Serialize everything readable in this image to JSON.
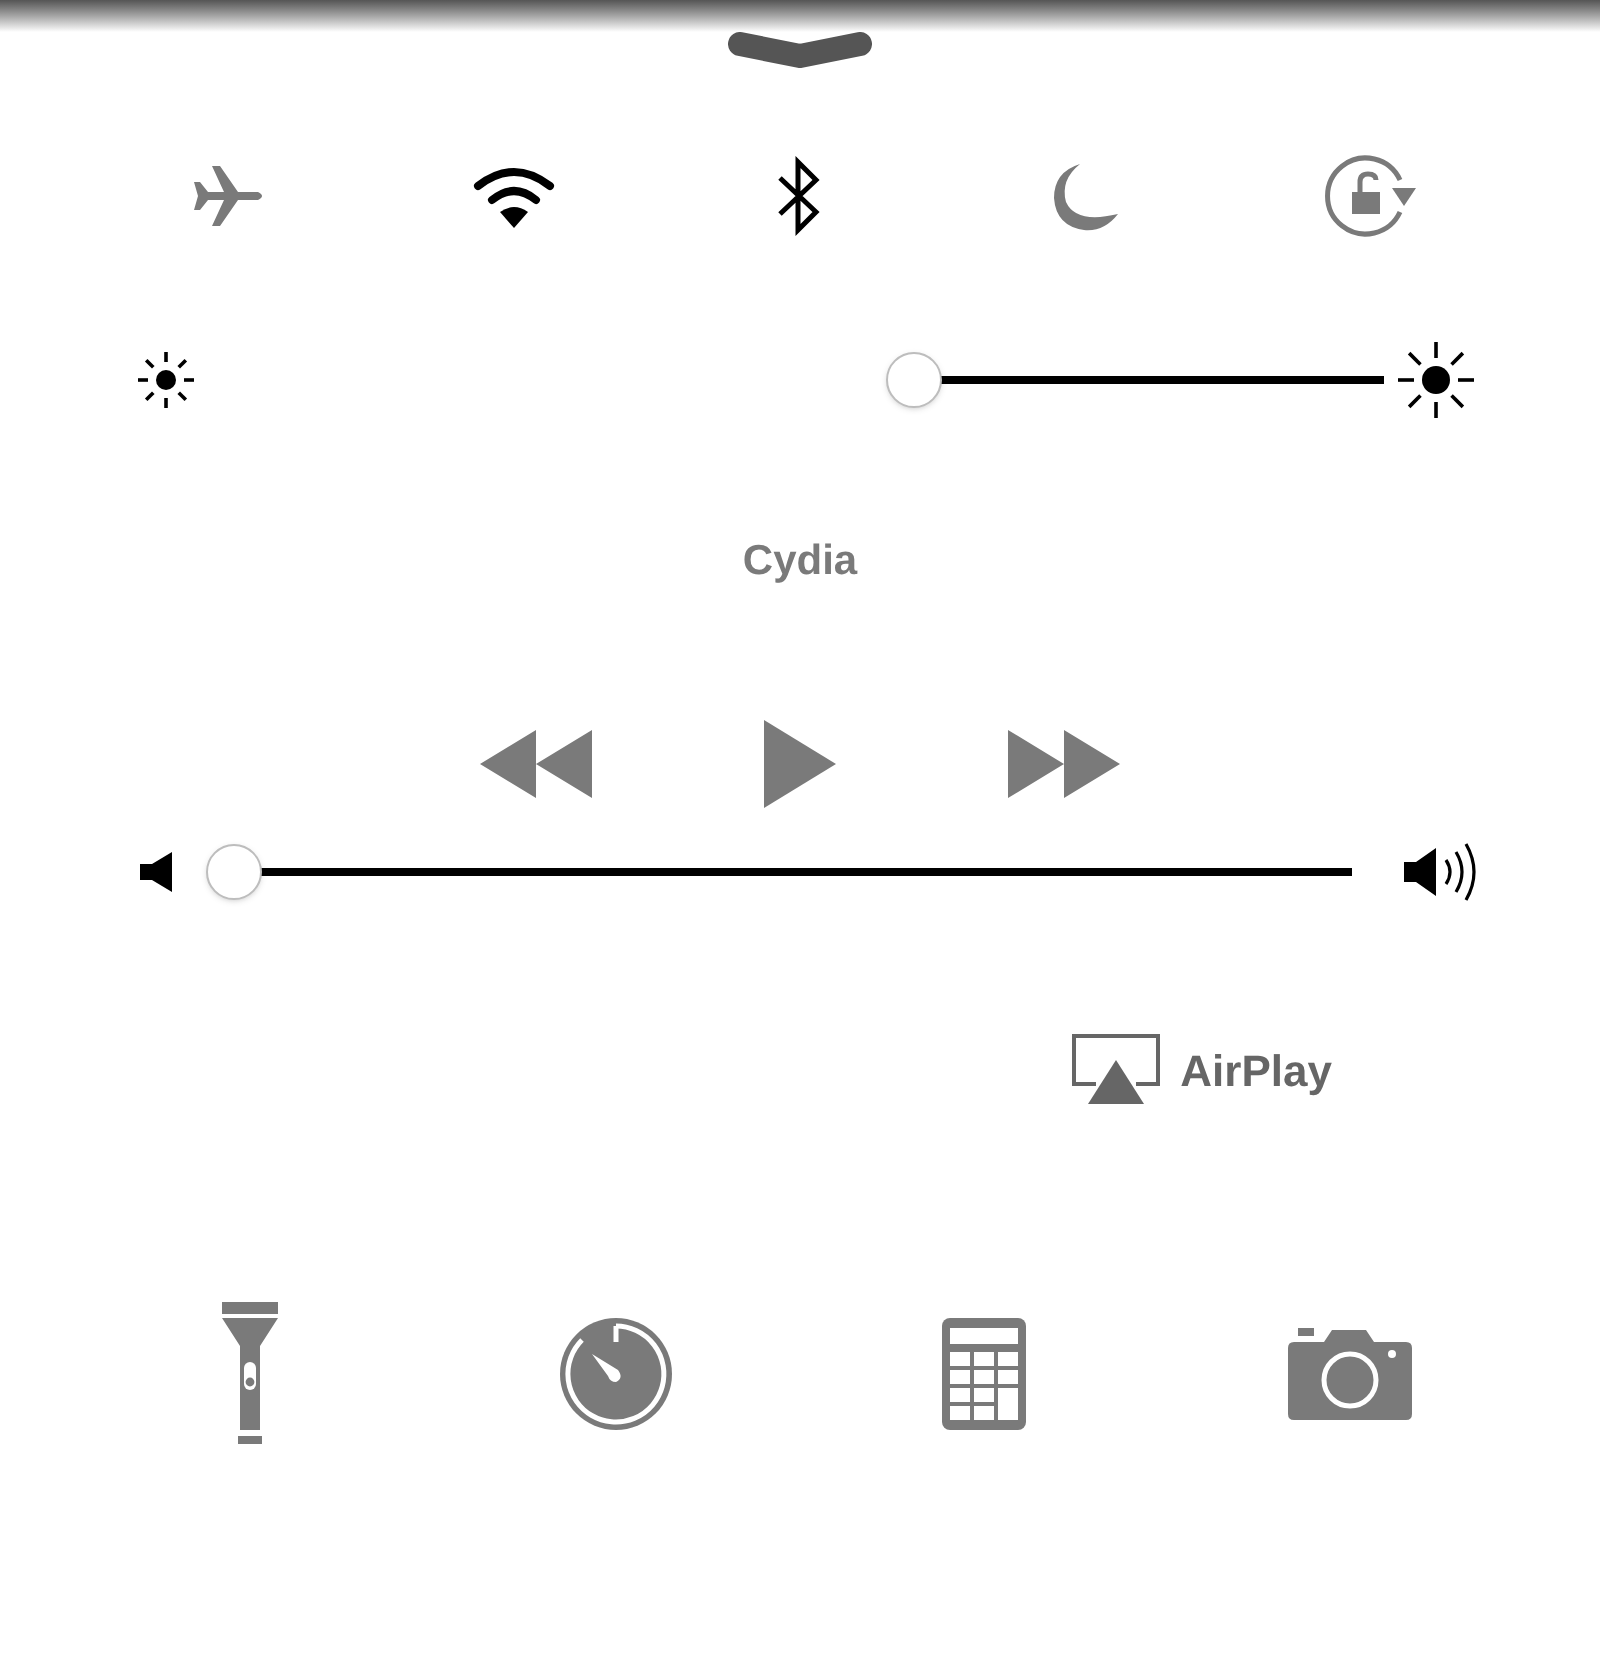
{
  "toggles": [
    {
      "kind": "airplane",
      "on": false
    },
    {
      "kind": "wifi",
      "on": true
    },
    {
      "kind": "bluetooth",
      "on": true
    },
    {
      "kind": "moon",
      "on": false
    },
    {
      "kind": "rotation",
      "on": false
    }
  ],
  "brightness": {
    "level": 0.6
  },
  "now_playing": {
    "title": "Cydia"
  },
  "media_controls": [
    {
      "kind": "rewind"
    },
    {
      "kind": "play"
    },
    {
      "kind": "forward"
    }
  ],
  "volume": {
    "level": 0.05
  },
  "airplay": {
    "label": "AirPlay"
  },
  "shortcuts": [
    {
      "kind": "flashlight"
    },
    {
      "kind": "timer"
    },
    {
      "kind": "calculator"
    },
    {
      "kind": "camera"
    }
  ]
}
